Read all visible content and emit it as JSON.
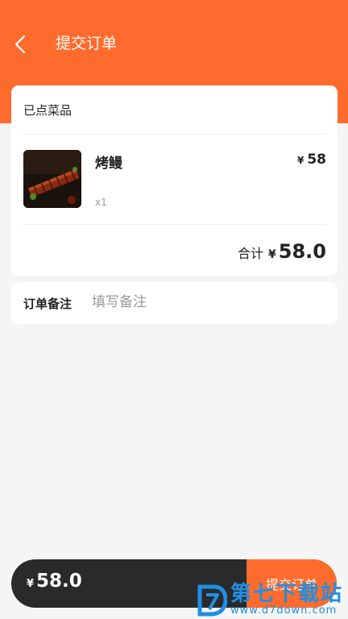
{
  "header": {
    "title": "提交订单",
    "bg_color": "#ff6b2c"
  },
  "order": {
    "section_title": "已点菜品",
    "items": [
      {
        "name": "烤鳗",
        "quantity": "x1",
        "currency": "¥",
        "price": "58",
        "image": "grilled-eel-photo"
      }
    ],
    "total_label": "合计",
    "total_currency": "¥",
    "total": "58.0"
  },
  "remark": {
    "label": "订单备注",
    "placeholder": "填写备注",
    "value": ""
  },
  "bottom_bar": {
    "currency": "¥",
    "total": "58.0",
    "submit_label": "提交订单",
    "bar_color": "#2a2a2a",
    "accent_color": "#ff6b2c"
  },
  "watermark": {
    "brand": "第七下载站",
    "url": "www.d7down.com",
    "color": "#1e90e6"
  }
}
